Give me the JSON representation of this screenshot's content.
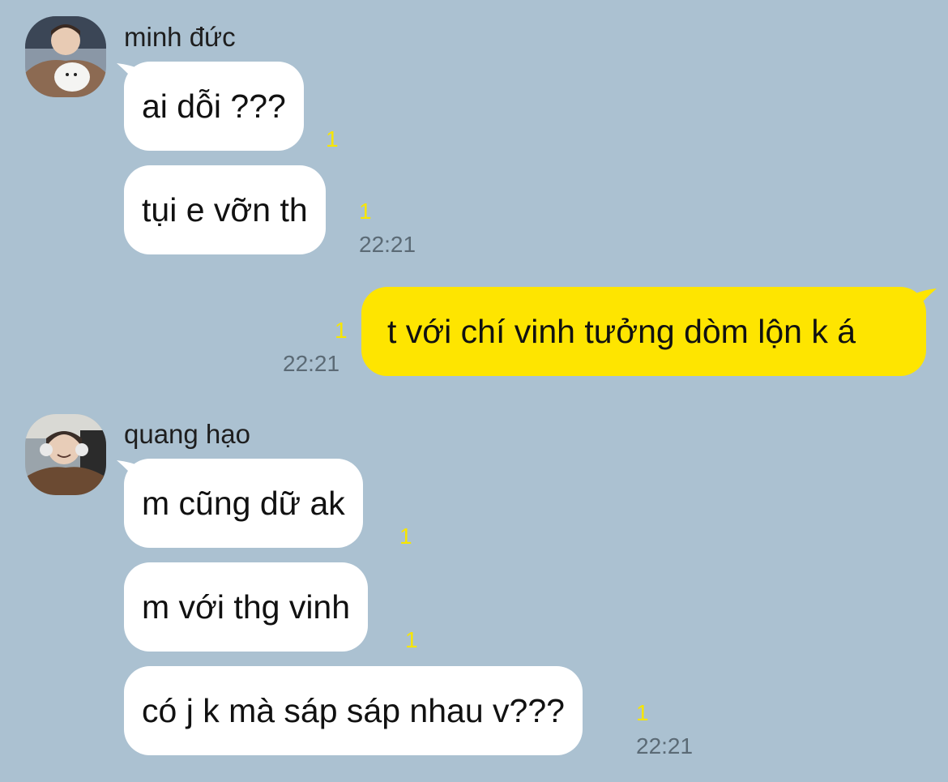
{
  "colors": {
    "background": "#abc1d1",
    "incoming_bubble": "#ffffff",
    "outgoing_bubble": "#fee500",
    "unread_counter": "#f7e600",
    "timestamp": "#5b6a75"
  },
  "messages": {
    "group1": {
      "sender": "minh đức",
      "m1": {
        "text": "ai dỗi ???",
        "unread": "1"
      },
      "m2": {
        "text": "tụi e vỡn th",
        "unread": "1",
        "time": "22:21"
      }
    },
    "outgoing": {
      "m1": {
        "text": "t với chí vinh tưởng dòm lộn k á",
        "unread": "1",
        "time": "22:21"
      }
    },
    "group2": {
      "sender": "quang hạo",
      "m1": {
        "text": "m cũng dữ ak",
        "unread": "1"
      },
      "m2": {
        "text": "m với thg vinh",
        "unread": "1"
      },
      "m3": {
        "text": "có j k mà sáp sáp nhau v???",
        "unread": "1",
        "time": "22:21"
      }
    }
  }
}
